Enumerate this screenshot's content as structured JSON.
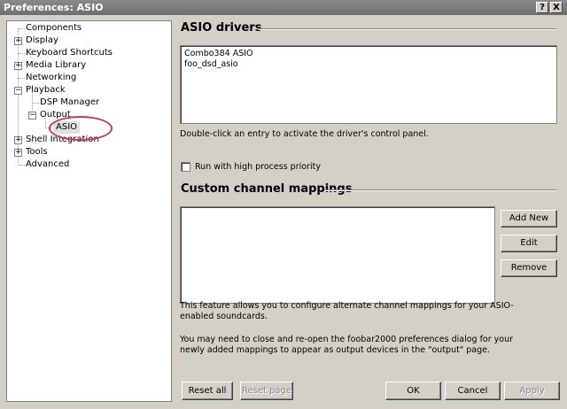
{
  "window": {
    "title": "Preferences: ASIO",
    "help_glyph": "?",
    "close_glyph": "X"
  },
  "tree": {
    "expander_glyph": "+",
    "collapse_glyph": "−",
    "items": [
      {
        "label": "Components"
      },
      {
        "label": "Display"
      },
      {
        "label": "Keyboard Shortcuts"
      },
      {
        "label": "Media Library"
      },
      {
        "label": "Networking"
      },
      {
        "label": "Playback"
      },
      {
        "label": "DSP Manager"
      },
      {
        "label": "Output"
      },
      {
        "label": "ASIO",
        "selected": true
      },
      {
        "label": "Shell Integration"
      },
      {
        "label": "Tools"
      },
      {
        "label": "Advanced"
      }
    ]
  },
  "asio_drivers": {
    "heading": "ASIO drivers",
    "items": [
      "Combo384 ASIO",
      "foo_dsd_asio"
    ],
    "hint": "Double-click an entry to activate the driver's control panel.",
    "priority_checkbox_label": "Run with high process priority",
    "priority_checked": false
  },
  "mappings": {
    "heading": "Custom channel mappings",
    "add_label": "Add New",
    "edit_label": "Edit",
    "remove_label": "Remove",
    "info_1": "This feature allows you to configure alternate channel mappings for your ASIO-enabled soundcards.",
    "info_2": "You may need to close and re-open the foobar2000 preferences dialog for your newly added mappings to appear as output devices in the \"output\" page."
  },
  "footer": {
    "reset_all": "Reset all",
    "reset_page": "Reset page",
    "ok": "OK",
    "cancel": "Cancel",
    "apply": "Apply"
  },
  "colors": {
    "highlight_circle": "#c8366a"
  }
}
